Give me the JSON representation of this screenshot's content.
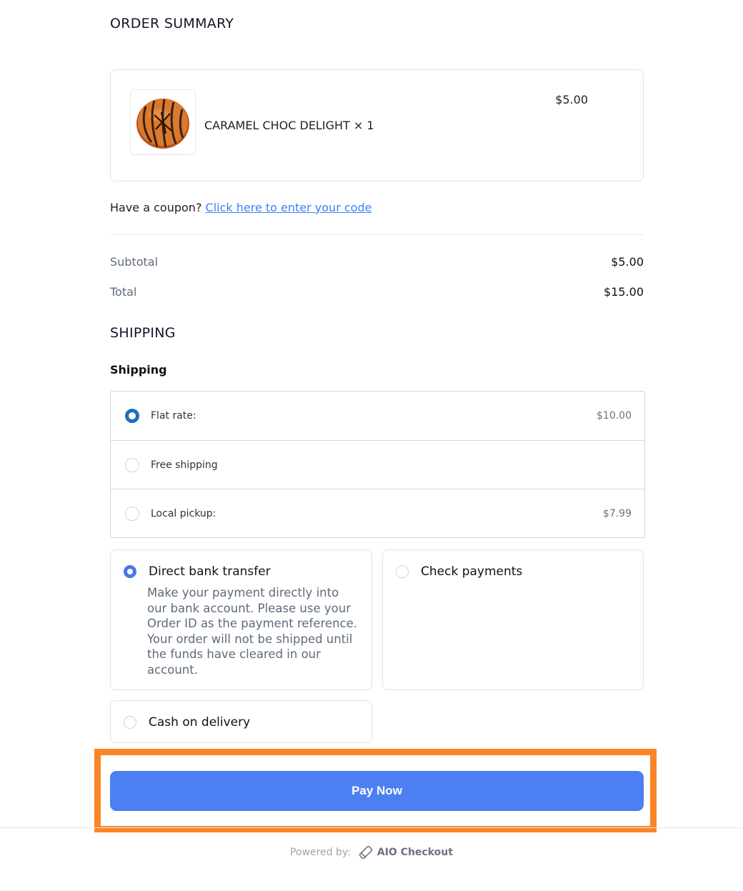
{
  "summary": {
    "title": "ORDER SUMMARY",
    "item": {
      "name": "CARAMEL CHOC DELIGHT × 1",
      "price": "$5.00"
    },
    "coupon_prompt": "Have a coupon?",
    "coupon_link": "Click here to enter your code",
    "subtotal_label": "Subtotal",
    "subtotal_value": "$5.00",
    "total_label": "Total",
    "total_value": "$15.00"
  },
  "shipping": {
    "title": "SHIPPING",
    "subtitle": "Shipping",
    "options": [
      {
        "name": "Flat rate:",
        "price": "$10.00",
        "selected": true
      },
      {
        "name": "Free shipping",
        "price": "",
        "selected": false
      },
      {
        "name": "Local pickup:",
        "price": "$7.99",
        "selected": false
      }
    ]
  },
  "payment": {
    "methods": [
      {
        "name": "Direct bank transfer",
        "selected": true,
        "description": "Make your payment directly into our bank account. Please use your Order ID as the payment reference. Your order will not be shipped until the funds have cleared in our account."
      },
      {
        "name": "Check payments",
        "selected": false
      },
      {
        "name": "Cash on delivery",
        "selected": false
      }
    ],
    "pay_button": "Pay Now"
  },
  "footer": {
    "powered_by": "Powered by:",
    "brand": "AIO Checkout"
  },
  "colors": {
    "accent": "#4c7ff1",
    "highlight": "#fb8526",
    "radio_selected": "#1f6fb5",
    "link": "#3b82f6"
  }
}
